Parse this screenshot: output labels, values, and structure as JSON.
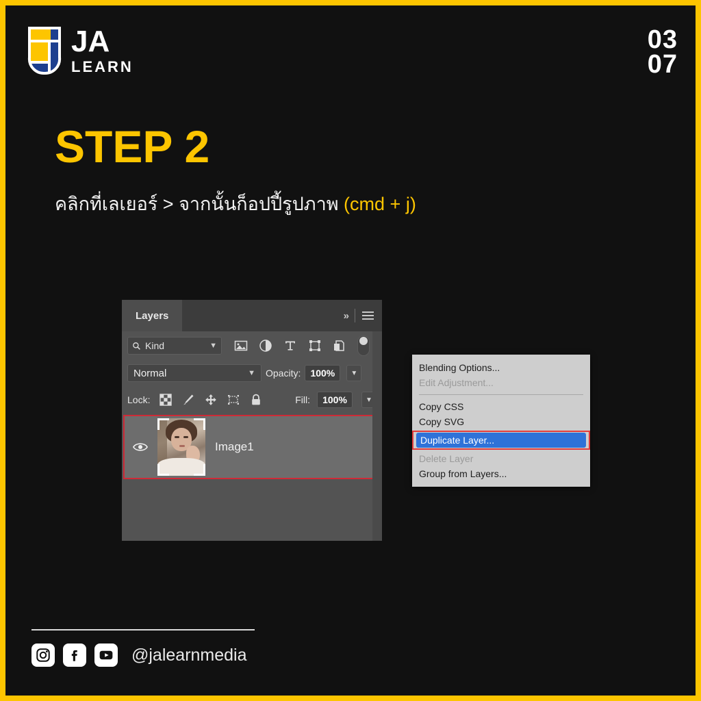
{
  "brand": {
    "logo_icon": "ja-shield-logo-icon",
    "wordmark_top": "JA",
    "wordmark_bottom": "LEARN",
    "yellow": "#fdc500",
    "blue": "#1d3f8f"
  },
  "page_number": {
    "current": "03",
    "total": "07"
  },
  "headline": {
    "step": "STEP 2"
  },
  "subtitle": {
    "thai": "คลิกที่เลเยอร์  > จากนั้นก็อปปี้รูปภาพ ",
    "shortcut": "(cmd + j)"
  },
  "layers_panel": {
    "tab_label": "Layers",
    "collapse_icon": "double-chevron-right-icon",
    "menu_icon": "hamburger-menu-icon",
    "filter": {
      "search_icon": "search-icon",
      "kind_label": "Kind",
      "chevron_icon": "chevron-down-icon",
      "icons": [
        "pixel-layer-filter-icon",
        "adjustment-layer-filter-icon",
        "type-layer-filter-icon",
        "shape-layer-filter-icon",
        "smart-object-filter-icon"
      ],
      "toggle_icon": "filter-toggle-switch"
    },
    "blend_mode": "Normal",
    "opacity_label": "Opacity:",
    "opacity_value": "100%",
    "lock_label": "Lock:",
    "lock_icons": [
      "lock-transparent-pixels-icon",
      "lock-image-pixels-icon",
      "lock-position-icon",
      "lock-artboard-nesting-icon",
      "lock-all-icon"
    ],
    "fill_label": "Fill:",
    "fill_value": "100%",
    "layer": {
      "visibility_icon": "eye-icon",
      "thumbnail_icon": "layer-thumbnail-portrait",
      "name": "Image1",
      "selected": true,
      "highlight_color": "#cf2a37"
    }
  },
  "context_menu": {
    "items": [
      {
        "label": "Blending Options...",
        "state": "enabled"
      },
      {
        "label": "Edit Adjustment...",
        "state": "disabled"
      },
      {
        "label": "Copy CSS",
        "state": "enabled"
      },
      {
        "label": "Copy SVG",
        "state": "enabled"
      },
      {
        "label": "Duplicate Layer...",
        "state": "selected"
      },
      {
        "label": "Delete Layer",
        "state": "disabled"
      },
      {
        "label": "Group from Layers...",
        "state": "enabled"
      }
    ],
    "selected_bg": "#2f72d8",
    "callout_color": "#e23b3b"
  },
  "footer": {
    "social": [
      "instagram-icon",
      "facebook-icon",
      "youtube-icon"
    ],
    "handle": "@jalearnmedia"
  }
}
